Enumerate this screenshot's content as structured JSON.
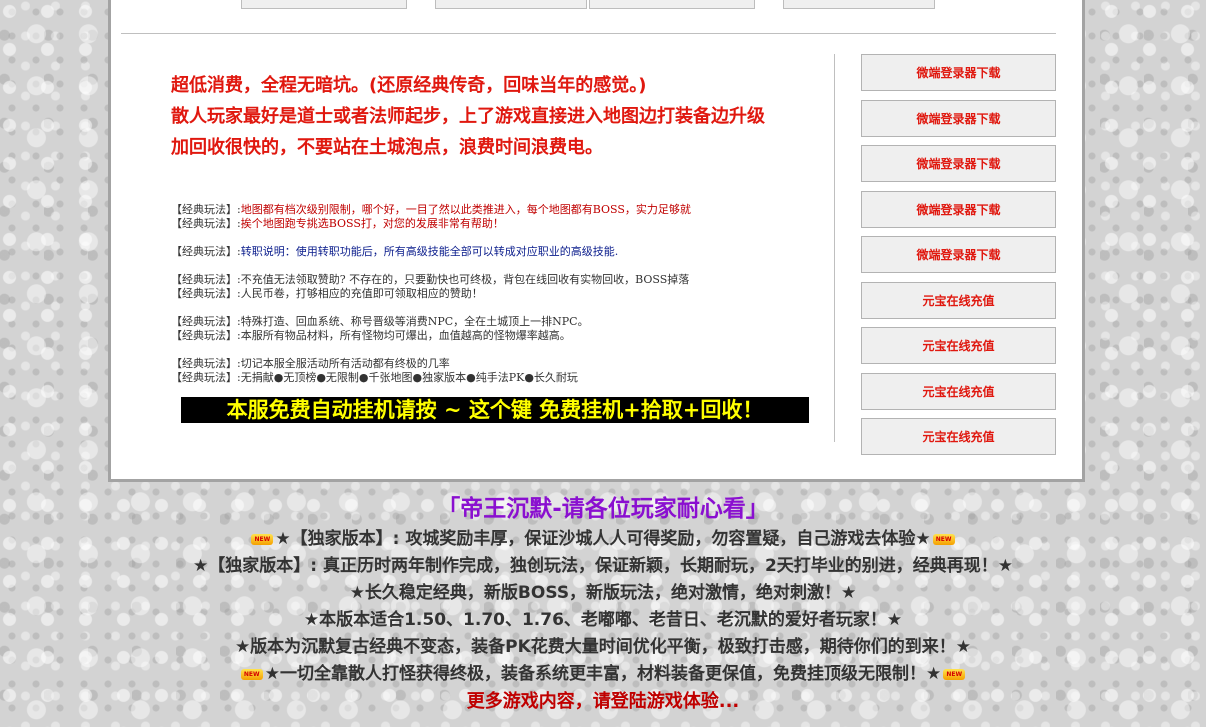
{
  "headlines": [
    "超低消费，全程无暗坑。(还原经典传奇，回味当年的感觉。)",
    "散人玩家最好是道士或者法师起步，上了游戏直接进入地图边打装备边升级",
    "加回收很快的，不要站在土城泡点，浪费时间浪费电。"
  ],
  "rules": [
    {
      "label": "【经典玩法】:",
      "text": "地图都有档次级别限制，哪个好，一目了然以此类推进入，每个地图都有BOSS，实力足够就",
      "style": "red"
    },
    {
      "label": "【经典玩法】:",
      "text": "挨个地图跑专挑选BOSS打，对您的发展非常有帮助！",
      "style": "red"
    },
    {
      "label": "【经典玩法】:",
      "text": "转职说明：使用转职功能后，所有高级技能全部可以转成对应职业的高级技能.",
      "style": "blue"
    },
    {
      "label": "【经典玩法】:",
      "text": "不充值无法领取赞助? 不存在的，只要勤快也可终极，背包在线回收有实物回收，BOSS掉落",
      "style": "grey"
    },
    {
      "label": "【经典玩法】:",
      "text": "人民币卷，打够相应的充值即可领取相应的赞助！",
      "style": "grey"
    },
    {
      "label": "【经典玩法】:",
      "text": "特殊打造、回血系统、称号晋级等消费NPC，全在土城顶上一排NPC。",
      "style": "grey"
    },
    {
      "label": "【经典玩法】:",
      "text": "本服所有物品材料，所有怪物均可爆出，血值越高的怪物爆率越高。",
      "style": "grey"
    },
    {
      "label": "【经典玩法】:",
      "text": "切记本服全服活动所有活动都有终极的几率",
      "style": "grey"
    },
    {
      "label": "【经典玩法】:",
      "text": "无捐献●无顶榜●无限制●千张地图●独家版本●纯手法PK●长久耐玩",
      "style": "grey"
    }
  ],
  "banner": "本服免费自动挂机请按 ~ 这个键 免费挂机+拾取+回收！",
  "side_buttons": [
    "微端登录器下载",
    "微端登录器下载",
    "微端登录器下载",
    "微端登录器下载",
    "微端登录器下载",
    "元宝在线充值",
    "元宝在线充值",
    "元宝在线充值",
    "元宝在线充值"
  ],
  "bottom": {
    "title": "「帝王沉默-请各位玩家耐心看」",
    "new_badge": "NEW",
    "lines": [
      "★【独家版本】: 攻城奖励丰厚，保证沙城人人可得奖励，勿容置疑，自己游戏去体验★",
      "★【独家版本】: 真正历时两年制作完成，独创玩法，保证新颖，长期耐玩，2天打毕业的别进，经典再现！★",
      "★长久稳定经典，新版BOSS，新版玩法，绝对激情，绝对刺激！★",
      "★本版本适合1.50、1.70、1.76、老嘟嘟、老昔日、老沉默的爱好者玩家！★",
      "★版本为沉默复古经典不变态，装备PK花费大量时间优化平衡，极致打击感，期待你们的到来！★",
      "★一切全靠散人打怪获得终极，装备系统更丰富，材料装备更保值，免费挂顶级无限制！★"
    ],
    "more": "更多游戏内容，请登陆游戏体验..."
  },
  "colors": {
    "headline_red": "#e0180f",
    "banner_bg": "#000000",
    "banner_text": "#ffff00",
    "title_purple": "#8a0fd0",
    "rule_blue": "#0a1c8c"
  }
}
